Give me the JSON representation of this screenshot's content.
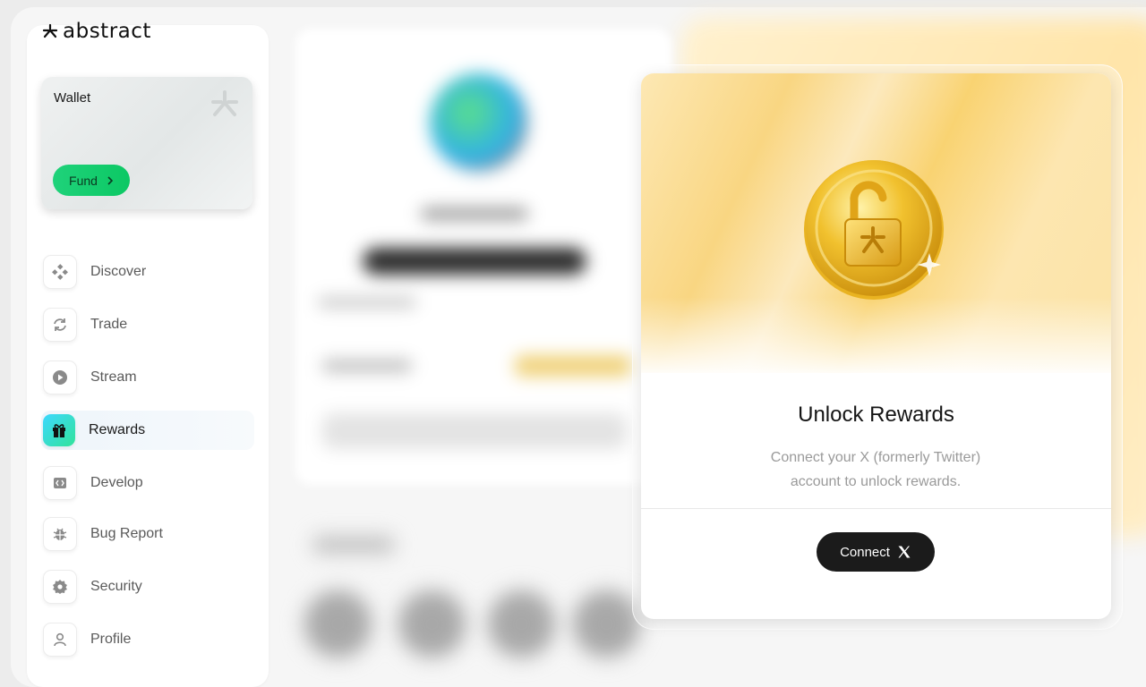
{
  "brand": {
    "name": "abstract"
  },
  "wallet": {
    "title": "Wallet",
    "fund_label": "Fund"
  },
  "nav": {
    "items": [
      {
        "label": "Discover",
        "icon": "discover-icon"
      },
      {
        "label": "Trade",
        "icon": "trade-icon"
      },
      {
        "label": "Stream",
        "icon": "play-icon"
      },
      {
        "label": "Rewards",
        "icon": "gift-icon",
        "active": true
      },
      {
        "label": "Develop",
        "icon": "code-icon"
      },
      {
        "label": "Bug Report",
        "icon": "bug-icon"
      },
      {
        "label": "Security",
        "icon": "gear-icon"
      },
      {
        "label": "Profile",
        "icon": "user-icon"
      }
    ]
  },
  "modal": {
    "title": "Unlock Rewards",
    "description_line1": "Connect your X (formerly Twitter)",
    "description_line2": "account to unlock rewards.",
    "connect_label": "Connect",
    "icon": "open-lock-coin-icon"
  },
  "colors": {
    "fund_green": "#1fd27a",
    "active_icon_gradient": [
      "#3dd8ff",
      "#31e39a"
    ],
    "connect_bg": "#1b1b1b",
    "hero_gold": "#f9d682"
  }
}
